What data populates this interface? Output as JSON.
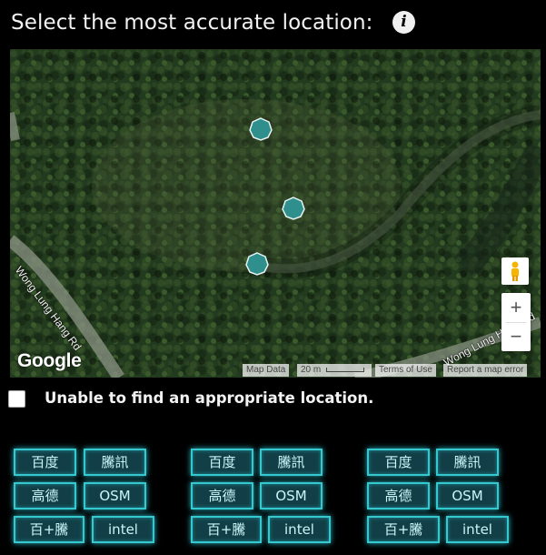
{
  "prompt": "Select the most accurate location:",
  "info_icon": "info-icon",
  "map": {
    "google_logo": "Google",
    "road_labels": [
      "Wong Lung Hang Rd",
      "Wong Lung Hang Rd"
    ],
    "attribution": {
      "map_data": "Map Data",
      "scale": "20 m",
      "terms": "Terms of Use",
      "report": "Report a map error"
    },
    "zoom_in": "+",
    "zoom_out": "−",
    "marker_color": "#2e8f8c"
  },
  "unable_label": "Unable to find an appropriate location.",
  "button_groups": [
    [
      "百度",
      "騰訊",
      "高德",
      "OSM",
      "百+騰",
      "intel"
    ],
    [
      "百度",
      "騰訊",
      "高德",
      "OSM",
      "百+騰",
      "intel"
    ],
    [
      "百度",
      "騰訊",
      "高德",
      "OSM",
      "百+騰",
      "intel"
    ]
  ],
  "colors": {
    "button_border": "#36c8cf",
    "button_fill": "#123f47",
    "background": "#000000"
  }
}
